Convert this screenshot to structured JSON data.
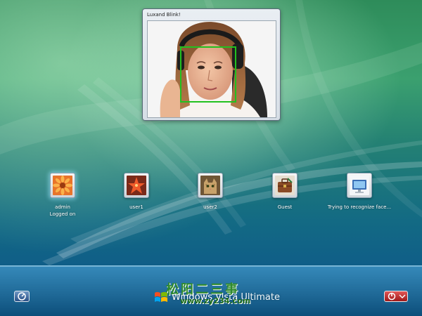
{
  "camera_window": {
    "title": "Luxand Blink!"
  },
  "users": [
    {
      "name": "admin",
      "status": "Logged on",
      "icon": "flower-picture-icon",
      "selected": true
    },
    {
      "name": "user1",
      "status": "",
      "icon": "starfish-picture-icon",
      "selected": false
    },
    {
      "name": "user2",
      "status": "",
      "icon": "cat-picture-icon",
      "selected": false
    },
    {
      "name": "Guest",
      "status": "",
      "icon": "briefcase-picture-icon",
      "selected": false
    },
    {
      "name": "Trying to recognize face...",
      "status": "",
      "icon": "monitor-picture-icon",
      "selected": false
    }
  ],
  "branding": {
    "product_word1": "Windows",
    "product_word2": "Vista",
    "edition": "Ultimate"
  },
  "watermark": {
    "cn_text": "松阳二三事",
    "url": "www.zy234.com"
  },
  "colors": {
    "face_box": "#22c11f",
    "power_button": "#c62b2b",
    "ease_button": "#3e68a4"
  }
}
